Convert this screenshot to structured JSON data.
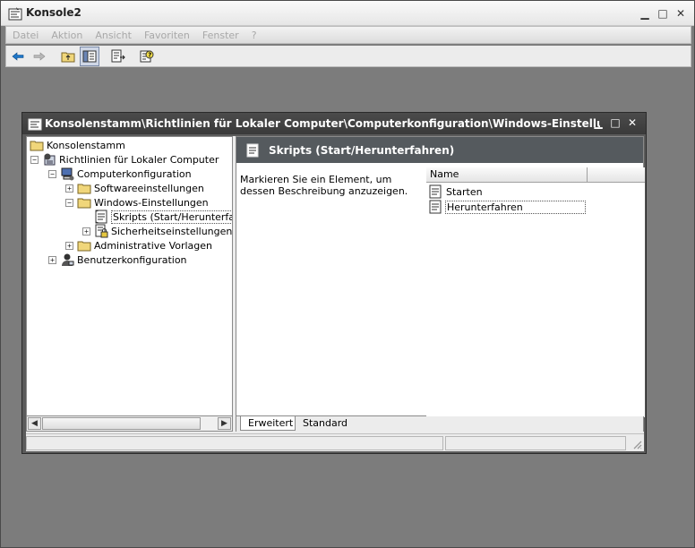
{
  "window": {
    "title": "Konsole2"
  },
  "menu": [
    {
      "label": "Datei",
      "key": "datei"
    },
    {
      "label": "Aktion",
      "key": "aktion"
    },
    {
      "label": "Ansicht",
      "key": "ansicht"
    },
    {
      "label": "Favoriten",
      "key": "favoriten"
    },
    {
      "label": "Fenster",
      "key": "fenster"
    },
    {
      "label": "?",
      "key": "help"
    }
  ],
  "toolbar": {
    "icons": [
      "back-arrow-icon",
      "forward-arrow-icon",
      "up-folder-icon",
      "show-hide-tree-icon",
      "export-list-icon",
      "help-icon"
    ]
  },
  "child": {
    "title": "Konsolenstamm\\Richtlinien für Lokaler Computer\\Computerkonfiguration\\Windows-Einstellungen\\Skripts..."
  },
  "tree": {
    "nodes": [
      {
        "label": "Konsolenstamm",
        "icon": "folder-icon"
      },
      {
        "label": "Richtlinien für Lokaler Computer",
        "icon": "policy-icon",
        "expander": "−"
      },
      {
        "label": "Computerkonfiguration",
        "icon": "computer-icon",
        "expander": "−"
      },
      {
        "label": "Softwareeinstellungen",
        "icon": "folder-icon",
        "expander": "+"
      },
      {
        "label": "Windows-Einstellungen",
        "icon": "folder-icon",
        "expander": "−"
      },
      {
        "label": "Skripts (Start/Herunterfahr",
        "icon": "script-icon"
      },
      {
        "label": "Sicherheitseinstellungen",
        "icon": "security-icon",
        "expander": "+"
      },
      {
        "label": "Administrative Vorlagen",
        "icon": "folder-icon",
        "expander": "+"
      },
      {
        "label": "Benutzerkonfiguration",
        "icon": "user-icon",
        "expander": "+"
      }
    ]
  },
  "right": {
    "header": "Skripts (Start/Herunterfahren)",
    "description": "Markieren Sie ein Element, um dessen Beschreibung anzuzeigen.",
    "columns": [
      "Name"
    ],
    "items": [
      {
        "label": "Starten"
      },
      {
        "label": "Herunterfahren"
      }
    ]
  },
  "tabs": [
    "Erweitert",
    "Standard"
  ],
  "colors": {
    "header_bg": "#555a5e",
    "workspace": "#7c7c7c"
  }
}
